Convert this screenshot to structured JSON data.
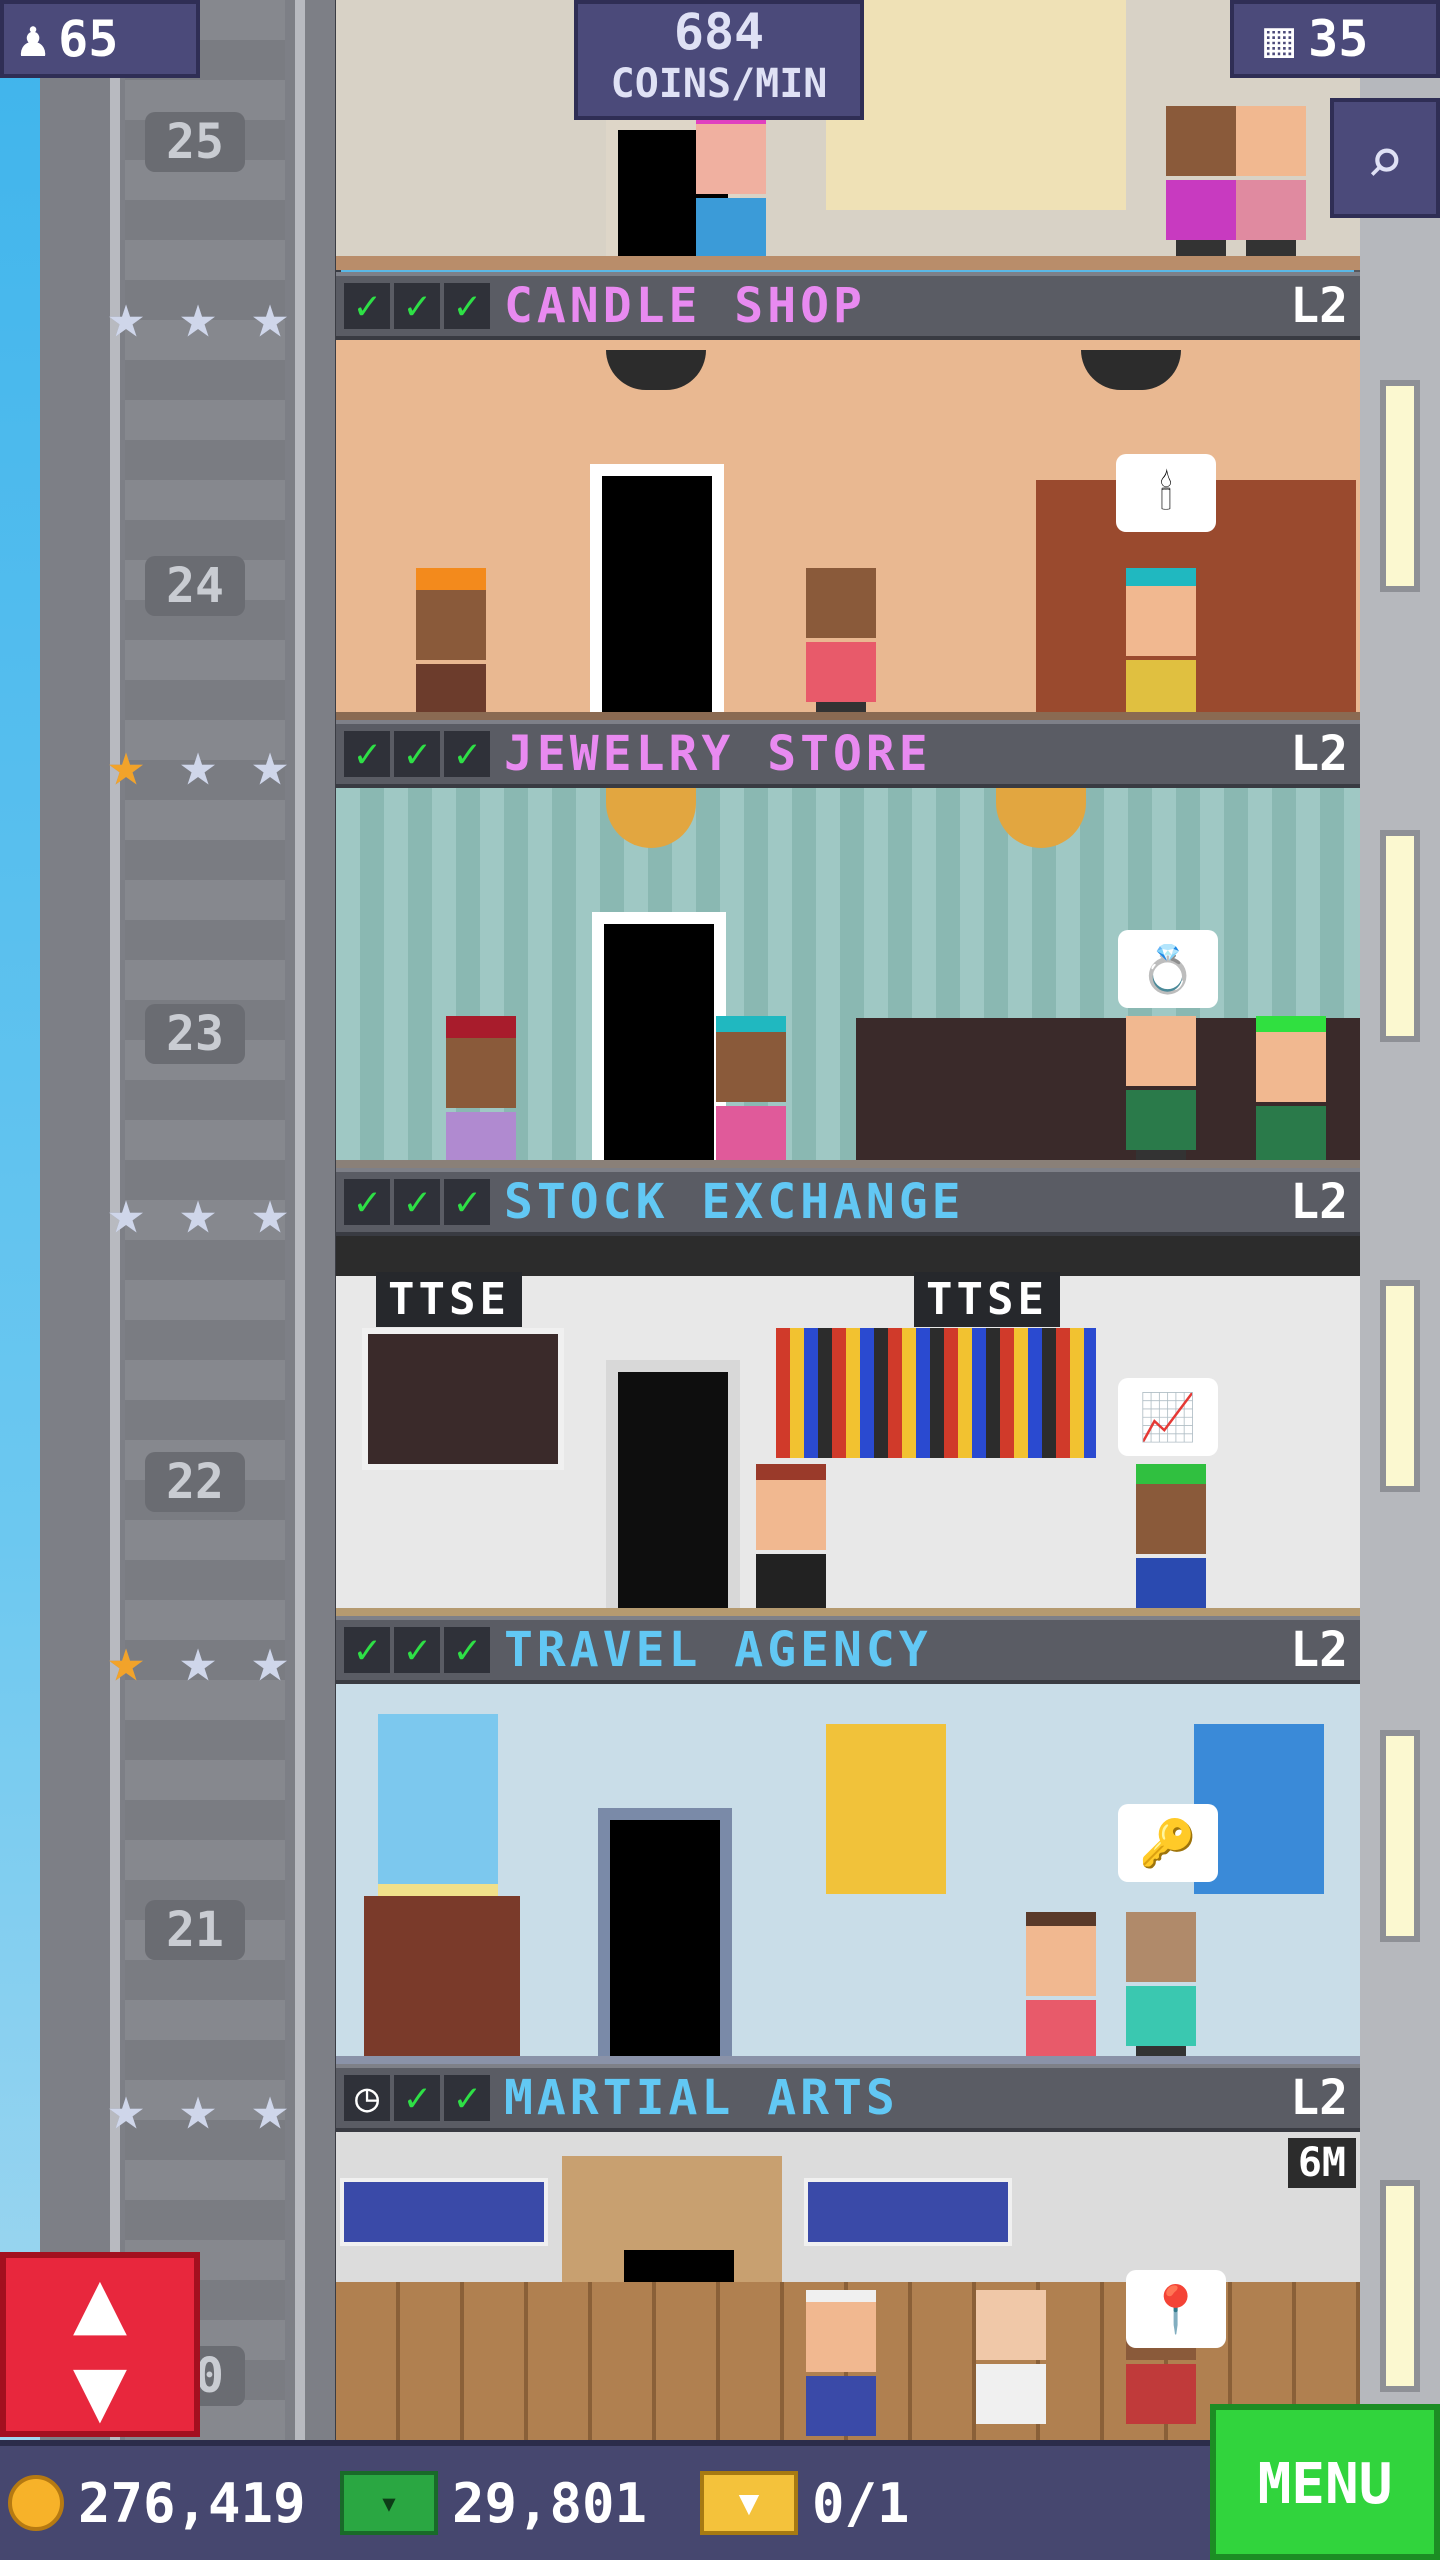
{
  "hud": {
    "population": "65",
    "coins_per_min_value": "684",
    "coins_per_min_unit": "COINS/MIN",
    "floor_count": "35",
    "icons": {
      "population": "person-icon",
      "floors": "building-icon",
      "search": "magnifier-icon"
    }
  },
  "floors": [
    {
      "number": "25",
      "name": "",
      "level": "",
      "stars_gold": 0
    },
    {
      "number": "24",
      "name": "CANDLE SHOP",
      "level": "L2",
      "checks": [
        "check",
        "check",
        "check"
      ],
      "stars_gold": 0,
      "name_color": "#e88af0",
      "wall_color": "#e9b891",
      "bubble": "🕯"
    },
    {
      "number": "23",
      "name": "JEWELRY STORE",
      "level": "L2",
      "checks": [
        "check",
        "check",
        "check"
      ],
      "stars_gold": 1,
      "name_color": "#e88af0",
      "wall_color": "#9fc8c4",
      "bubble": "💍"
    },
    {
      "number": "22",
      "name": "STOCK EXCHANGE",
      "level": "L2",
      "checks": [
        "check",
        "check",
        "check"
      ],
      "stars_gold": 0,
      "name_color": "#62c8f4",
      "wall_color": "#e8e8e8",
      "signs": [
        "TTSE",
        "TTSE"
      ],
      "bubble": "📈"
    },
    {
      "number": "21",
      "name": "TRAVEL AGENCY",
      "level": "L2",
      "checks": [
        "check",
        "check",
        "check"
      ],
      "stars_gold": 1,
      "name_color": "#62c8f4",
      "wall_color": "#c9dde8",
      "bubble": "🔑"
    },
    {
      "number": "20",
      "name": "MARTIAL ARTS",
      "level": "L2",
      "checks": [
        "clock",
        "check",
        "check"
      ],
      "stars_gold": 0,
      "name_color": "#62c8f4",
      "wall_color": "#dcdcdc",
      "timer": "6M",
      "bubble": "📍"
    }
  ],
  "bottom_bar": {
    "coins": "276,419",
    "bux": "29,801",
    "tickets": "0/1",
    "menu_label": "MENU"
  },
  "colors": {
    "hud_bg": "#4b4a7a",
    "menu_green": "#31d43d",
    "elevator_red": "#e8273d",
    "check_green": "#2ee046"
  }
}
